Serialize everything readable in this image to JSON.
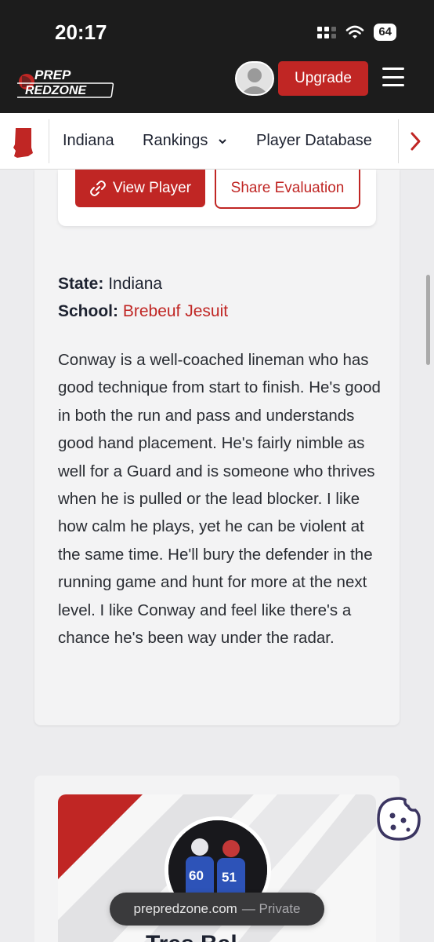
{
  "status_bar": {
    "time": "20:17",
    "battery": "64",
    "icons": [
      "signal-icon",
      "wifi-icon",
      "battery-icon"
    ]
  },
  "header": {
    "logo_line1": "PREP",
    "logo_line2": "REDZONE",
    "upgrade_label": "Upgrade",
    "icons": [
      "avatar-icon",
      "menu-icon"
    ]
  },
  "nav": {
    "state_label": "Indiana",
    "rankings_label": "Rankings",
    "database_label": "Player Database",
    "icons": [
      "indiana-state-icon",
      "chevron-down-icon",
      "chevron-right-icon"
    ]
  },
  "actions": {
    "view_player_label": "View Player",
    "share_label": "Share Evaluation"
  },
  "player": {
    "state_label": "State:",
    "state_value": "Indiana",
    "school_label": "School:",
    "school_value": "Brebeuf Jesuit",
    "evaluation": "Conway is a well-coached lineman who has good technique from start to finish. He's good in both the run and pass and understands good hand placement. He's fairly nimble as well for a Guard and is someone who thrives when he is pulled or the lead blocker. I like how calm he plays, yet he can be violent at the same time. He'll bury the defender in the running game and hunt for more at the next level. I like Conway and feel like there's a chance he's been way under the radar."
  },
  "next_player": {
    "name": "Tres Bal",
    "jersey_left": "60",
    "jersey_right": "51"
  },
  "browser": {
    "url": "prepredzone.com",
    "mode": "— Private"
  },
  "colors": {
    "brand_red": "#c02624",
    "dark": "#1c1c1c",
    "cookie_purple": "#3b3561"
  }
}
